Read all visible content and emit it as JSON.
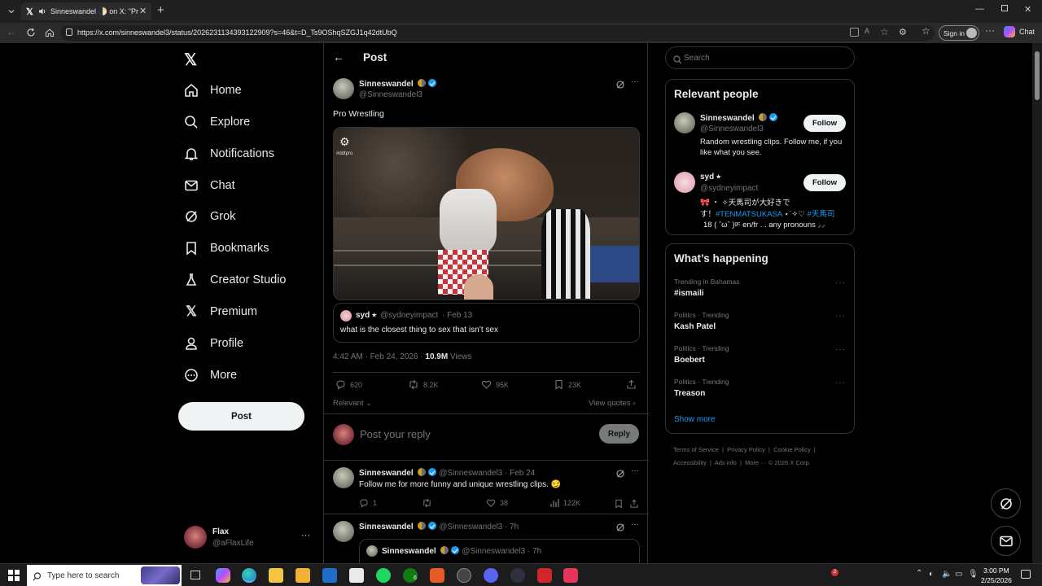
{
  "browser": {
    "tab_title": "Sinneswandel 🌓 on X: \"Pro W",
    "url": "https://x.com/sinneswandel3/status/2026231134393122909?s=46&t=D_Ts9OShqSZGJ1q42dtUbQ",
    "sign_in": "Sign in",
    "chat": "Chat"
  },
  "sidebar": {
    "items": [
      {
        "label": "Home"
      },
      {
        "label": "Explore"
      },
      {
        "label": "Notifications"
      },
      {
        "label": "Chat"
      },
      {
        "label": "Grok"
      },
      {
        "label": "Bookmarks"
      },
      {
        "label": "Creator Studio"
      },
      {
        "label": "Premium"
      },
      {
        "label": "Profile"
      },
      {
        "label": "More"
      }
    ],
    "post_button": "Post",
    "account": {
      "name": "Flax",
      "handle": "@aFlaxLife"
    }
  },
  "main": {
    "header_title": "Post",
    "post": {
      "author_name": "Sinneswandel",
      "author_handle": "@Sinneswandel3",
      "text": "Pro Wrestling",
      "video_watermark": "#ddtpro",
      "quote": {
        "name": "syd ⭑",
        "handle": "@sydneyimpact",
        "date": "· Feb 13",
        "text": "what is the closest thing to sex that isn’t sex"
      },
      "timestamp": "4:42 AM · Feb 24, 2026 ·",
      "views_count": "10.9M",
      "views_label": "Views",
      "replies": "620",
      "reposts": "8.2K",
      "likes": "95K",
      "bookmarks": "23K",
      "sort_label": "Relevant",
      "view_quotes": "View quotes"
    },
    "reply_box": {
      "placeholder": "Post your reply",
      "button": "Reply"
    },
    "replies_list": [
      {
        "name": "Sinneswandel",
        "handle": "@Sinneswandel3",
        "date": "· Feb 24",
        "text": "Follow me for more funny and unique wrestling clips. 😏",
        "replies": "1",
        "reposts": "",
        "likes": "38",
        "views": "122K"
      },
      {
        "name": "Sinneswandel",
        "handle": "@Sinneswandel3",
        "date": "· 7h",
        "nested_name": "Sinneswandel",
        "nested_handle": "@Sinneswandel3",
        "nested_date": "· 7h"
      }
    ]
  },
  "right": {
    "search_placeholder": "Search",
    "relevant_people": {
      "title": "Relevant people",
      "people": [
        {
          "name": "Sinneswandel",
          "handle": "@Sinneswandel3",
          "bio": "Random wrestling clips. Follow me, if you like what you see.",
          "follow": "Follow"
        },
        {
          "name": "syd ⭑",
          "handle": "@sydneyimpact",
          "bio_line1": "🎀 ‧ ✧天馬司が大好きで",
          "bio_line2_pre": "す！",
          "bio_tag1": "#TENMATSUKASA",
          "bio_line2_mid": " ⋆˙✧♡ ",
          "bio_tag2": "#天馬司",
          "bio_line3": "18 ( ˆωˆ )ᵍᶜ en/fr . . any pronouns  ⸝⸝",
          "follow": "Follow"
        }
      ]
    },
    "whats_happening": {
      "title": "What’s happening",
      "trends": [
        {
          "category": "Trending in Bahamas",
          "name": "#ismaili"
        },
        {
          "category": "Politics · Trending",
          "name": "Kash Patel"
        },
        {
          "category": "Politics · Trending",
          "name": "Boebert"
        },
        {
          "category": "Politics · Trending",
          "name": "Treason"
        }
      ],
      "show_more": "Show more"
    },
    "footer": {
      "links": [
        "Terms of Service",
        "Privacy Policy",
        "Cookie Policy",
        "Accessibility",
        "Ads info",
        "More ···"
      ],
      "copyright": "© 2026 X Corp."
    }
  },
  "taskbar": {
    "search_placeholder": "Type here to search",
    "time": "3:00 PM",
    "date": "2/25/2026",
    "notification_count": "2",
    "xbox_badge": "6"
  },
  "colors": {
    "accent": "#1d9bf0",
    "background": "#000000",
    "border": "#2f3336",
    "muted": "#71767b"
  }
}
